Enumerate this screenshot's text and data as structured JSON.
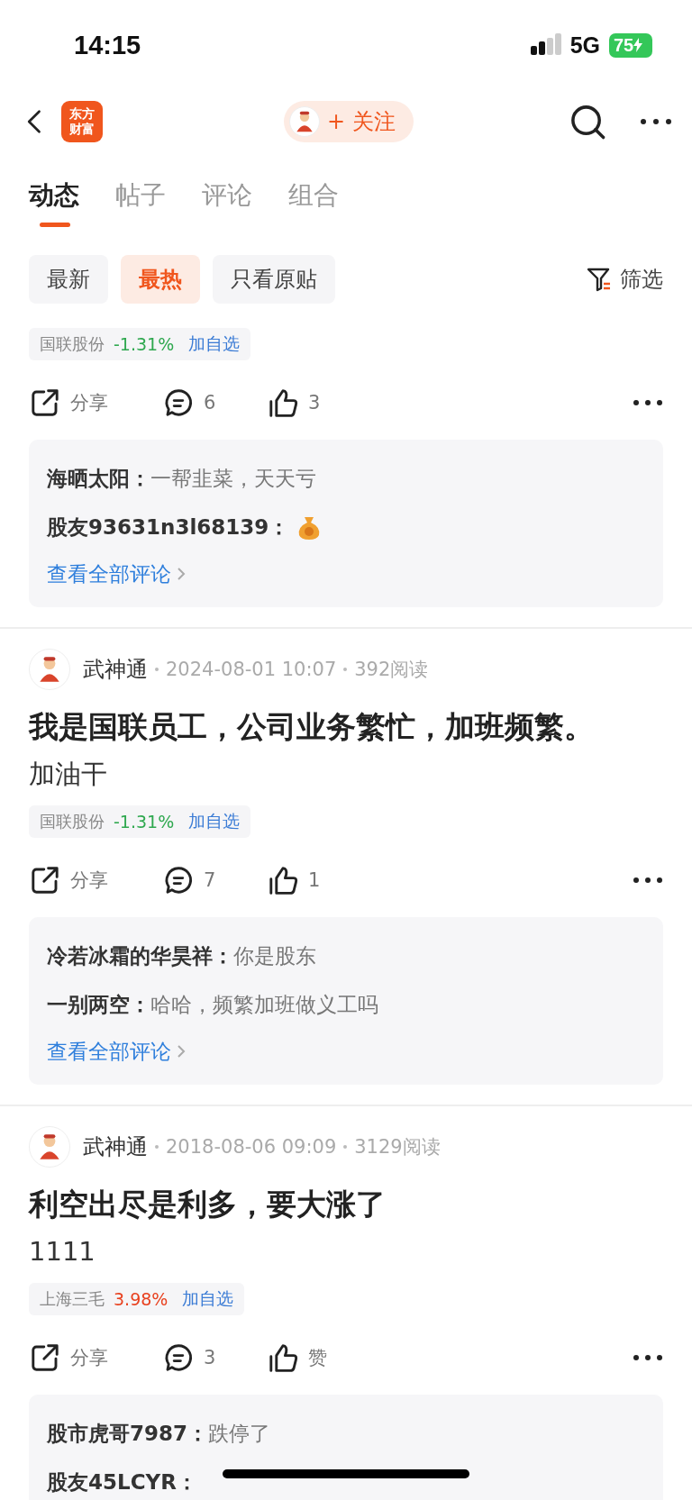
{
  "status_bar": {
    "time": "14:15",
    "network": "5G",
    "battery": "75"
  },
  "header": {
    "logo_lines": [
      "东方",
      "财富"
    ],
    "follow_button": "+ 关注"
  },
  "tabs": [
    {
      "label": "动态",
      "selected": true
    },
    {
      "label": "帖子",
      "selected": false
    },
    {
      "label": "评论",
      "selected": false
    },
    {
      "label": "组合",
      "selected": false
    }
  ],
  "filters": [
    {
      "label": "最新",
      "selected": false
    },
    {
      "label": "最热",
      "selected": true
    },
    {
      "label": "只看原贴",
      "selected": false
    }
  ],
  "filter_button": "筛选",
  "posts": [
    {
      "stock": {
        "name": "国联股份",
        "change": "-1.31%",
        "color": "#2fa84f",
        "add": "加自选"
      },
      "actions": {
        "share": "分享",
        "comments": "6",
        "likes": "3"
      },
      "comments": [
        {
          "kind": "text",
          "user": "海晒太阳：",
          "text": "一帮韭菜，天天亏"
        },
        {
          "kind": "sticker",
          "user": "股友93631n3l68139："
        }
      ],
      "view_all": "查看全部评论"
    },
    {
      "author": "武神通",
      "time": "2024-08-01 10:07",
      "reads": "392阅读",
      "title": "我是国联员工，公司业务繁忙，加班频繁。",
      "body": "加油干",
      "stock": {
        "name": "国联股份",
        "change": "-1.31%",
        "color": "#2fa84f",
        "add": "加自选"
      },
      "actions": {
        "share": "分享",
        "comments": "7",
        "likes": "1"
      },
      "comments": [
        {
          "kind": "text",
          "user": "冷若冰霜的华昊祥：",
          "text": "你是股东"
        },
        {
          "kind": "text",
          "user": "一别两空：",
          "text": "哈哈，频繁加班做义工吗"
        }
      ],
      "view_all": "查看全部评论"
    },
    {
      "author": "武神通",
      "time": "2018-08-06 09:09",
      "reads": "3129阅读",
      "title": "利空出尽是利多，要大涨了",
      "body": "1111",
      "stock": {
        "name": "上海三毛",
        "change": "3.98%",
        "color": "#e8411f",
        "add": "加自选"
      },
      "actions": {
        "share": "分享",
        "comments": "3",
        "likes": "赞"
      },
      "comments": [
        {
          "kind": "text",
          "user": "股市虎哥7987：",
          "text": "跌停了"
        },
        {
          "kind": "text",
          "user": "股友45LCYR："
        }
      ]
    }
  ]
}
